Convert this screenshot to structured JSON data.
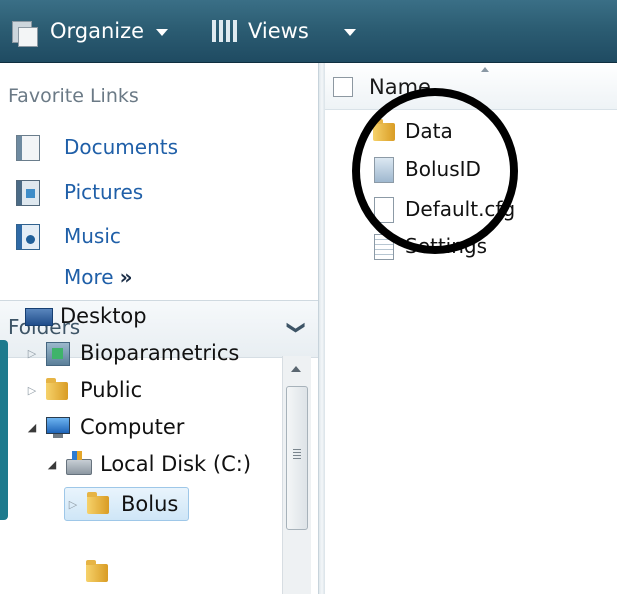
{
  "toolbar": {
    "organize_label": "Organize",
    "views_label": "Views"
  },
  "navigation": {
    "favorites_title": "Favorite Links",
    "favorites": [
      {
        "label": "Documents",
        "icon": "documents-icon"
      },
      {
        "label": "Pictures",
        "icon": "pictures-icon"
      },
      {
        "label": "Music",
        "icon": "music-icon"
      }
    ],
    "more_label": "More",
    "more_chevron": "»",
    "folders_title": "Folders",
    "folders_toggle": "❯",
    "tree": [
      {
        "label": "Desktop",
        "icon": "desktop-icon",
        "expander": ""
      },
      {
        "label": "Bioparametrics",
        "icon": "bioparametrics-icon",
        "expander": "▷"
      },
      {
        "label": "Public",
        "icon": "folder-icon",
        "expander": "▷"
      },
      {
        "label": "Computer",
        "icon": "computer-icon",
        "expander": "◢"
      },
      {
        "label": "Local Disk (C:)",
        "icon": "local-disk-icon",
        "expander": "◢"
      },
      {
        "label": "Bolus",
        "icon": "folder-icon",
        "expander": "▷",
        "selected": true
      }
    ]
  },
  "file_list": {
    "column_name": "Name",
    "items": [
      {
        "label": "Data",
        "icon": "folder-icon"
      },
      {
        "label": "BolusID",
        "icon": "document-icon"
      },
      {
        "label": "Default.cfg",
        "icon": "file-icon"
      },
      {
        "label": "Settings",
        "icon": "document-icon"
      }
    ]
  },
  "colors": {
    "toolbar_top": "#3a6f86",
    "toolbar_bottom": "#1f4b62",
    "link_blue": "#1f5fa8",
    "selection_bg": "#cfe6f7",
    "annotation_circle": "#000000"
  }
}
